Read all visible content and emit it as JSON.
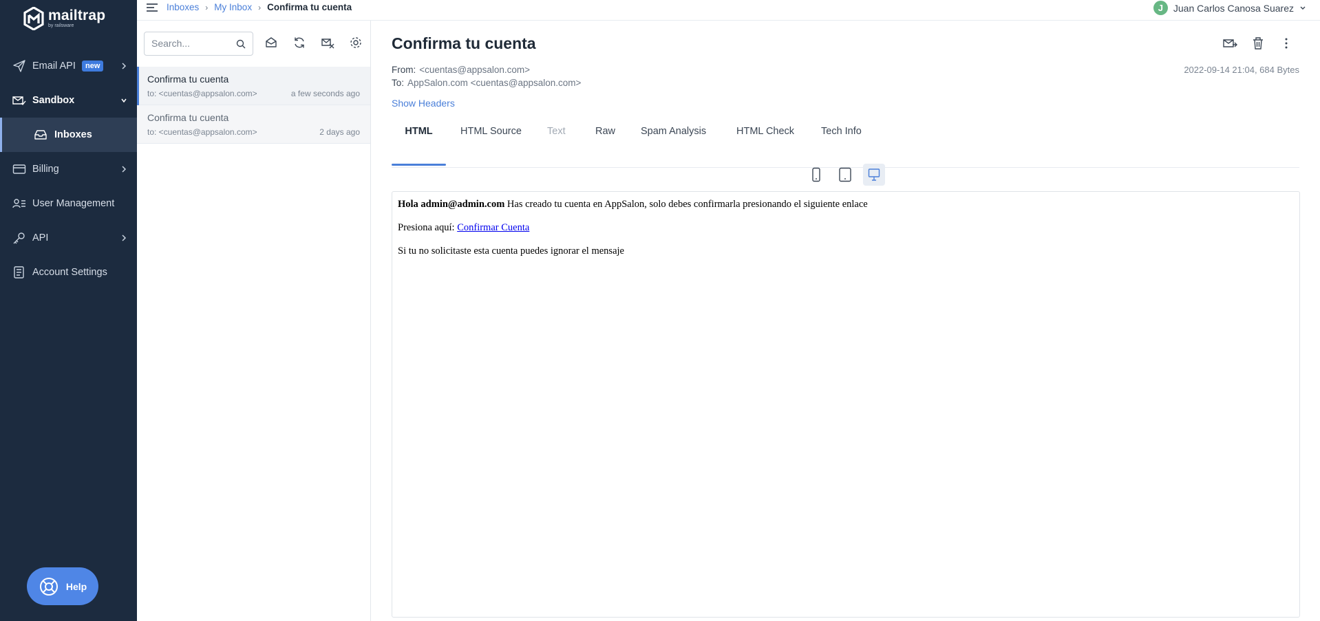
{
  "brand": {
    "name": "mailtrap",
    "tagline": "by railsware"
  },
  "sidebar": {
    "items": [
      {
        "label": "Email API",
        "badge": "new",
        "icon": "paper-plane-icon"
      },
      {
        "label": "Sandbox",
        "icon": "envelope-check-icon"
      },
      {
        "label": "Inboxes",
        "icon": "inbox-tray-icon"
      },
      {
        "label": "Billing",
        "icon": "credit-card-icon"
      },
      {
        "label": "User Management",
        "icon": "users-icon"
      },
      {
        "label": "API",
        "icon": "key-icon"
      },
      {
        "label": "Account Settings",
        "icon": "document-settings-icon"
      }
    ],
    "help_label": "Help"
  },
  "topbar": {
    "breadcrumb": [
      "Inboxes",
      "My Inbox",
      "Confirma tu cuenta"
    ],
    "user_initial": "J",
    "user_name": "Juan Carlos Canosa Suarez"
  },
  "search": {
    "placeholder": "Search..."
  },
  "messages": [
    {
      "subject": "Confirma tu cuenta",
      "to": "to: <cuentas@appsalon.com>",
      "time": "a few seconds ago"
    },
    {
      "subject": "Confirma tu cuenta",
      "to": "to: <cuentas@appsalon.com>",
      "time": "2 days ago"
    }
  ],
  "email": {
    "subject": "Confirma tu cuenta",
    "from_label": "From:",
    "from": "<cuentas@appsalon.com>",
    "to_label": "To:",
    "to": "AppSalon.com <cuentas@appsalon.com>",
    "meta": "2022-09-14 21:04, 684 Bytes",
    "show_headers": "Show Headers",
    "tabs": [
      "HTML",
      "HTML Source",
      "Text",
      "Raw",
      "Spam Analysis",
      "HTML Check",
      "Tech Info"
    ],
    "body": {
      "greeting_bold": "Hola admin@admin.com",
      "greeting_rest": " Has creado tu cuenta en AppSalon, solo debes confirmarla presionando el siguiente enlace",
      "press_text": "Presiona aquí: ",
      "link_text": "Confirmar Cuenta",
      "ignore_text": "Si tu no solicitaste esta cuenta puedes ignorar el mensaje"
    }
  },
  "colors": {
    "sidebar_bg": "#1c2b3f",
    "accent": "#4a7fd9",
    "help_bg": "#4f86e6",
    "avatar": "#67b784"
  }
}
